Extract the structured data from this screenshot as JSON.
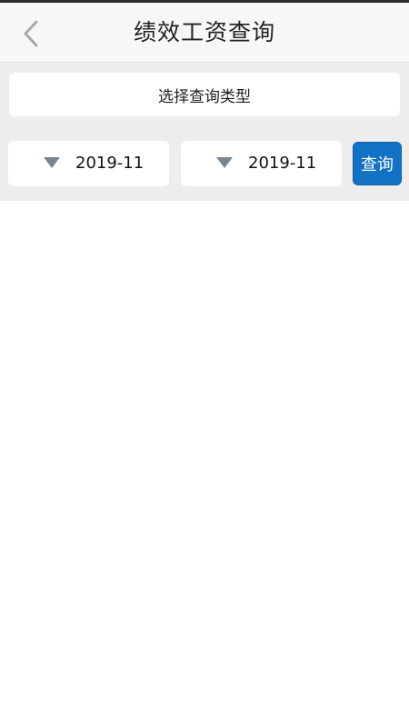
{
  "header": {
    "title": "绩效工资查询",
    "back_icon": "chevron-left-icon"
  },
  "filters": {
    "type_selector_label": "选择查询类型",
    "start_date": "2019-11",
    "end_date": "2019-11",
    "dropdown_icon": "caret-down-icon",
    "query_button_label": "查询"
  },
  "colors": {
    "header_bg": "#f7f7f7",
    "filter_bg": "#ededed",
    "accent": "#1273c6",
    "icon_gray": "#a8a8a8",
    "caret_gray": "#7a8590"
  }
}
